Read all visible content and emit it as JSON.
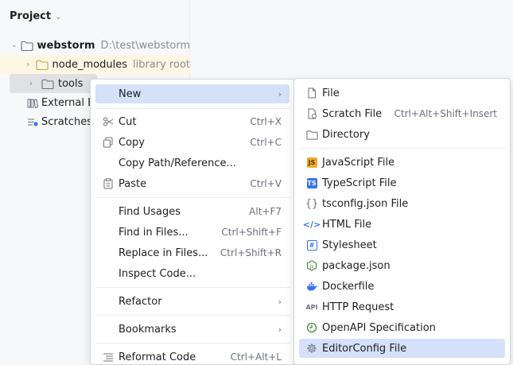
{
  "project": {
    "title": "Project",
    "tree": {
      "root_name": "webstorm",
      "root_path": "D:\\test\\webstorm",
      "node_modules": "node_modules",
      "node_modules_tag": "library root",
      "tools": "tools",
      "external": "External Li",
      "scratches": "Scratches"
    }
  },
  "context_menu": {
    "new": "New",
    "cut": "Cut",
    "cut_sc": "Ctrl+X",
    "copy": "Copy",
    "copy_sc": "Ctrl+C",
    "copy_path": "Copy Path/Reference...",
    "paste": "Paste",
    "paste_sc": "Ctrl+V",
    "find_usages": "Find Usages",
    "find_usages_sc": "Alt+F7",
    "find_in_files": "Find in Files...",
    "find_in_files_sc": "Ctrl+Shift+F",
    "replace_in_files": "Replace in Files...",
    "replace_in_files_sc": "Ctrl+Shift+R",
    "inspect_code": "Inspect Code...",
    "refactor": "Refactor",
    "bookmarks": "Bookmarks",
    "reformat_code": "Reformat Code",
    "reformat_code_sc": "Ctrl+Alt+L"
  },
  "new_submenu": {
    "file": "File",
    "scratch": "Scratch File",
    "scratch_sc": "Ctrl+Alt+Shift+Insert",
    "directory": "Directory",
    "js": "JavaScript File",
    "ts": "TypeScript File",
    "tsconfig": "tsconfig.json File",
    "html": "HTML File",
    "stylesheet": "Stylesheet",
    "package": "package.json",
    "docker": "Dockerfile",
    "http": "HTTP Request",
    "openapi": "OpenAPI Specification",
    "editorconfig": "EditorConfig File"
  },
  "colors": {
    "selection": "#d5e1f8",
    "library_bg": "#fdf6e3",
    "js": "#f0a732",
    "ts": "#3574f0",
    "html": "#3574f0",
    "docker": "#3574f0"
  }
}
